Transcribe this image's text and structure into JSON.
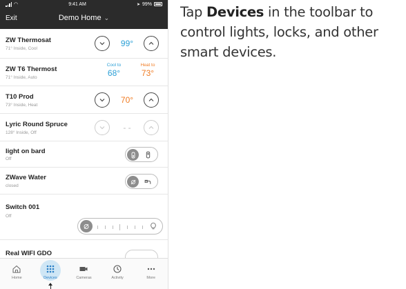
{
  "status_bar": {
    "time": "9:41 AM",
    "battery": "99%"
  },
  "navbar": {
    "exit_label": "Exit",
    "title": "Demo Home",
    "title_chevron": "⌄"
  },
  "devices": [
    {
      "name": "ZW Thermosat",
      "status": "71° Inside, Cool",
      "setpoint": "99°",
      "mode": "cool"
    },
    {
      "name": "ZW T6 Thermost",
      "status": "71° Inside, Auto",
      "cool_label": "Cool to",
      "cool_value": "68°",
      "heat_label": "Heat to",
      "heat_value": "73°"
    },
    {
      "name": "T10 Prod",
      "status": "73° Inside, Heat",
      "setpoint": "70°",
      "mode": "heat"
    },
    {
      "name": "Lyric Round Spruce",
      "status": "128° Inside, Off",
      "setpoint": "- -",
      "mode": "off"
    },
    {
      "name": "light on bard",
      "status": "Off",
      "type": "switch",
      "state": "off"
    },
    {
      "name": "ZWave Water",
      "status": "closed",
      "type": "valve",
      "state": "closed"
    },
    {
      "name": "Switch 001",
      "status": "Off",
      "type": "dimmer",
      "level": 0
    },
    {
      "name": "Real WIFI GDO",
      "status": "",
      "type": "garage"
    }
  ],
  "tabbar": {
    "tabs": [
      {
        "label": "Home",
        "icon": "home-icon"
      },
      {
        "label": "Devices",
        "icon": "devices-grid-icon",
        "active": true
      },
      {
        "label": "Cameras",
        "icon": "camera-icon"
      },
      {
        "label": "Activity",
        "icon": "clock-icon"
      },
      {
        "label": "More",
        "icon": "more-dots-icon"
      }
    ]
  },
  "instruction": {
    "prefix": "Tap ",
    "highlight": "Devices",
    "suffix": " in the toolbar to control lights, locks, and other smart devices."
  },
  "colors": {
    "navbar": "#2b2b2b",
    "cool": "#2a9fd6",
    "heat": "#f07b22",
    "active_tab": "#2a7fc6"
  }
}
